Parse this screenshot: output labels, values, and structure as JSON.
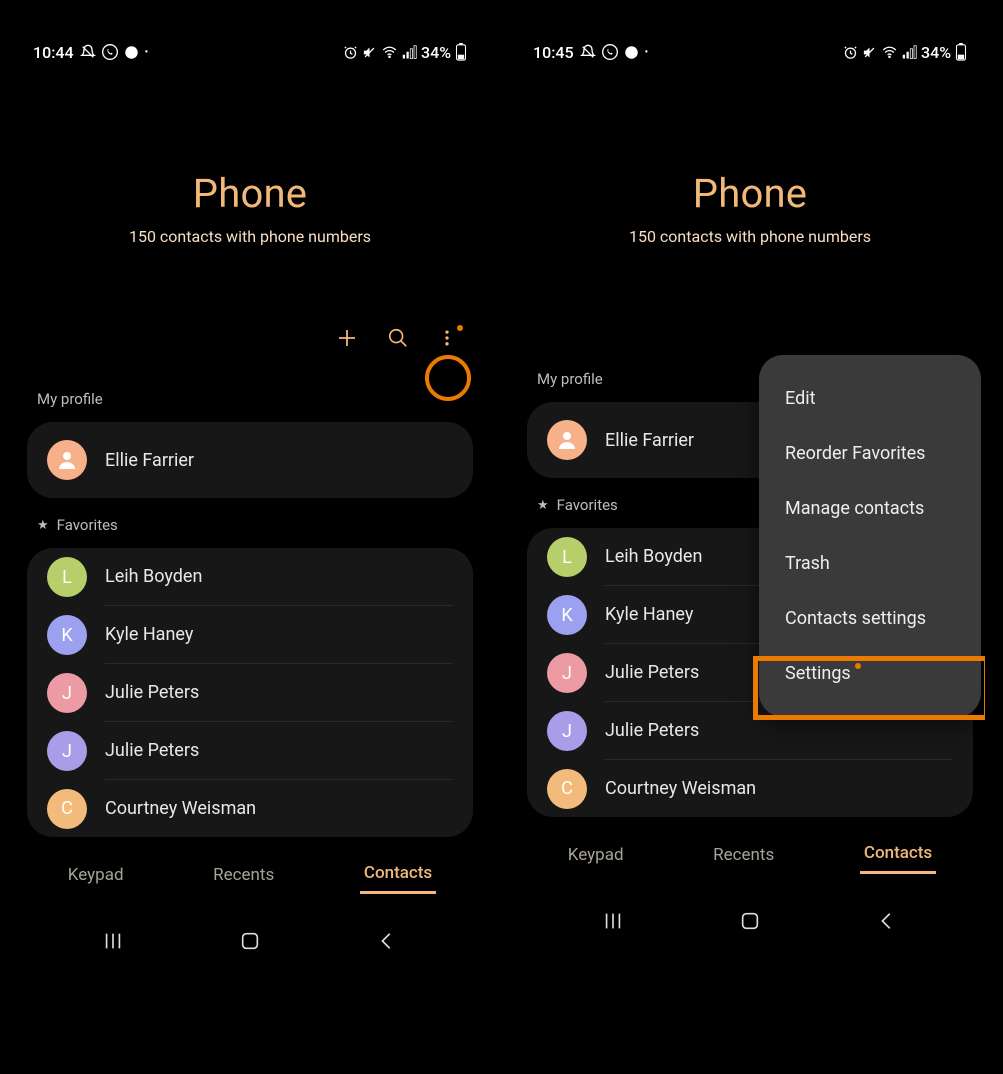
{
  "screens": {
    "left": {
      "statusbar": {
        "time": "10:44",
        "battery": "34%"
      },
      "header": {
        "title": "Phone",
        "subtitle": "150 contacts with phone numbers"
      },
      "sections": {
        "profile_label": "My profile",
        "favorites_label": "Favorites",
        "profile": {
          "name": "Ellie Farrier"
        },
        "favorites": [
          {
            "initial": "L",
            "color": "#b6cf6b",
            "name": "Leih Boyden"
          },
          {
            "initial": "K",
            "color": "#9ba0ef",
            "name": "Kyle Haney"
          },
          {
            "initial": "J",
            "color": "#ec9aa4",
            "name": "Julie Peters"
          },
          {
            "initial": "J",
            "color": "#a99de9",
            "name": "Julie Peters"
          },
          {
            "initial": "C",
            "color": "#f2bb7b",
            "name": "Courtney Weisman"
          }
        ]
      },
      "tabs": {
        "keypad": "Keypad",
        "recents": "Recents",
        "contacts": "Contacts"
      }
    },
    "right": {
      "statusbar": {
        "time": "10:45",
        "battery": "34%"
      },
      "header": {
        "title": "Phone",
        "subtitle": "150 contacts with phone numbers"
      },
      "sections": {
        "profile_label": "My profile",
        "favorites_label": "Favorites",
        "profile": {
          "name": "Ellie Farrier"
        },
        "favorites": [
          {
            "initial": "L",
            "color": "#b6cf6b",
            "name": "Leih Boyden"
          },
          {
            "initial": "K",
            "color": "#9ba0ef",
            "name": "Kyle Haney"
          },
          {
            "initial": "J",
            "color": "#ec9aa4",
            "name": "Julie Peters"
          },
          {
            "initial": "J",
            "color": "#a99de9",
            "name": "Julie Peters"
          },
          {
            "initial": "C",
            "color": "#f2bb7b",
            "name": "Courtney Weisman"
          }
        ]
      },
      "menu": {
        "items": [
          {
            "label": "Edit"
          },
          {
            "label": "Reorder Favorites"
          },
          {
            "label": "Manage contacts"
          },
          {
            "label": "Trash"
          },
          {
            "label": "Contacts settings"
          },
          {
            "label": "Settings",
            "dot": true
          }
        ]
      },
      "tabs": {
        "keypad": "Keypad",
        "recents": "Recents",
        "contacts": "Contacts"
      }
    }
  }
}
